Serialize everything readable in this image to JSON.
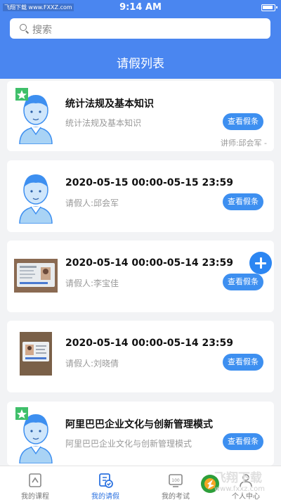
{
  "status_bar": {
    "source_tag": "飞翔下载 www.FXXZ.com",
    "time": "9:14 AM"
  },
  "search": {
    "placeholder": "搜索"
  },
  "page": {
    "title": "请假列表"
  },
  "cards": [
    {
      "title": "统计法规及基本知识",
      "subtitle": "统计法规及基本知识",
      "extra": "讲师:邱会军 -",
      "button": "查看假条"
    },
    {
      "title": "2020-05-15 00:00-05-15 23:59",
      "subtitle": "请假人:邱会军",
      "button": "查看假条"
    },
    {
      "title": "2020-05-14 00:00-05-14 23:59",
      "subtitle": "请假人:李宝佳",
      "button": "查看假条"
    },
    {
      "title": "2020-05-14 00:00-05-14 23:59",
      "subtitle": "请假人:刘晓倩",
      "button": "查看假条"
    },
    {
      "title": "阿里巴巴企业文化与创新管理模式",
      "subtitle": "阿里巴巴企业文化与创新管理模式",
      "button": "查看假条"
    }
  ],
  "tabs": [
    {
      "label": "我的课程",
      "icon": "course-icon"
    },
    {
      "label": "我的请假",
      "icon": "leave-icon",
      "active": true
    },
    {
      "label": "我的考试",
      "icon": "exam-icon"
    },
    {
      "label": "个人中心",
      "icon": "profile-icon"
    }
  ],
  "watermark": {
    "text": "飞翔下载",
    "url": "www.fxxz.com"
  },
  "colors": {
    "primary": "#4a86f0",
    "button": "#3d8ff0",
    "active_tab": "#2c72e0"
  }
}
